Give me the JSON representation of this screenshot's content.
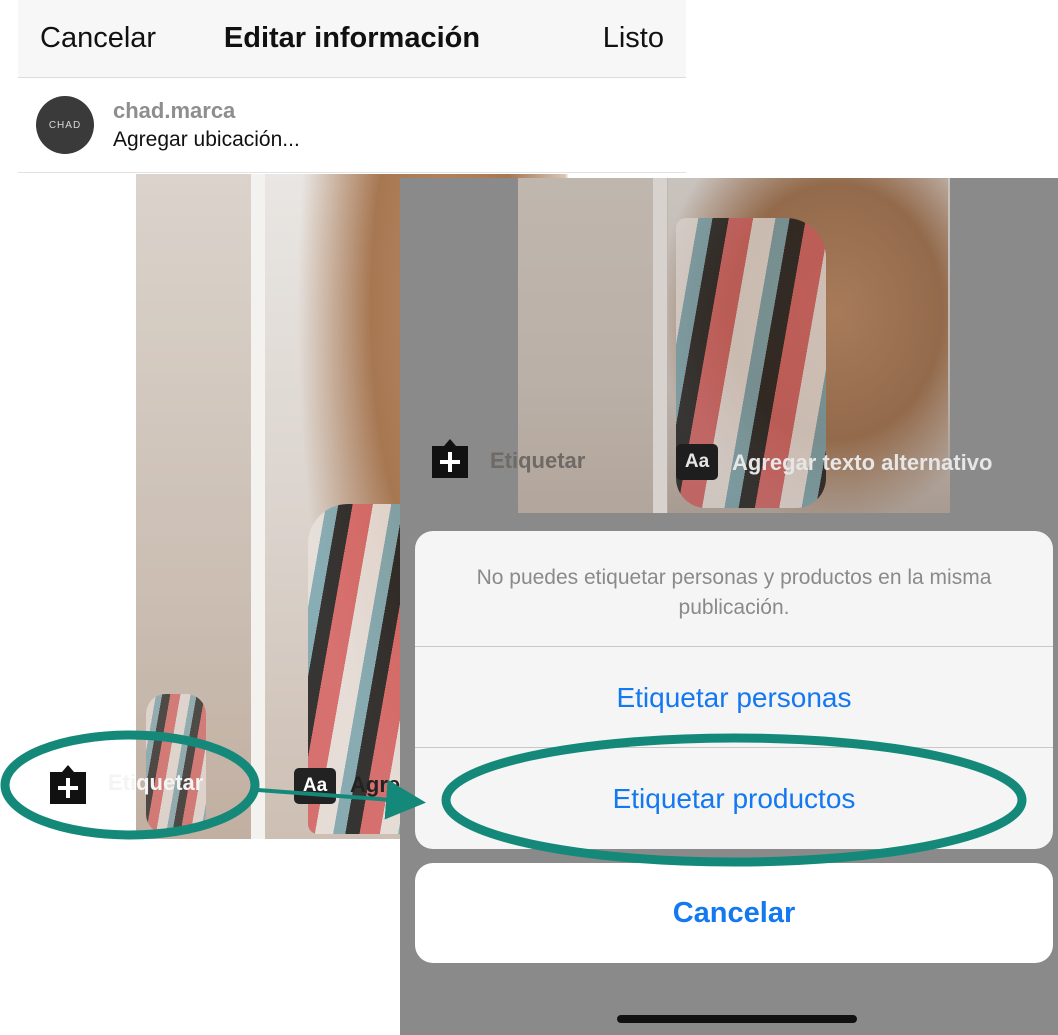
{
  "edit_screen": {
    "cancel_label": "Cancelar",
    "title": "Editar información",
    "done_label": "Listo",
    "avatar_text": "CHAD",
    "username": "chad.marca",
    "add_location": "Agregar ubicación...",
    "tag_label": "Etiquetar",
    "alt_badge": "Aa",
    "alt_label": "Agre"
  },
  "overlay": {
    "tag_label": "Etiquetar",
    "alt_badge": "Aa",
    "alt_label": "Agregar texto alternativo",
    "action_sheet": {
      "message": "No puedes etiquetar personas y productos en la misma publicación.",
      "option_people": "Etiquetar personas",
      "option_products": "Etiquetar productos",
      "cancel": "Cancelar"
    }
  },
  "colors": {
    "ios_blue": "#1478f0",
    "annotation_teal": "#14897a",
    "overlay_dim": "#8a8a8a"
  },
  "icons": [
    "plus-tag-icon",
    "alt-text-badge-icon"
  ]
}
